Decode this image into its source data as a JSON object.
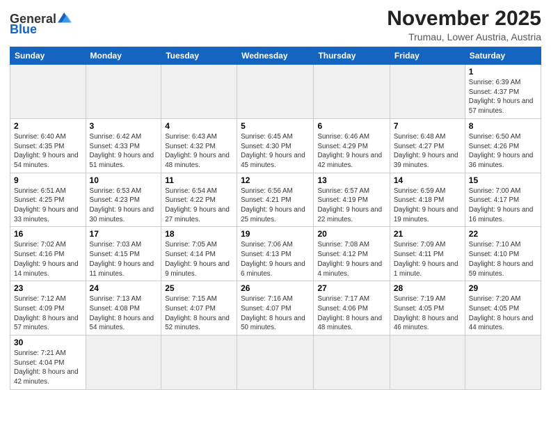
{
  "logo": {
    "general": "General",
    "blue": "Blue"
  },
  "header": {
    "month_title": "November 2025",
    "subtitle": "Trumau, Lower Austria, Austria"
  },
  "weekdays": [
    "Sunday",
    "Monday",
    "Tuesday",
    "Wednesday",
    "Thursday",
    "Friday",
    "Saturday"
  ],
  "weeks": [
    [
      {
        "day": "",
        "empty": true
      },
      {
        "day": "",
        "empty": true
      },
      {
        "day": "",
        "empty": true
      },
      {
        "day": "",
        "empty": true
      },
      {
        "day": "",
        "empty": true
      },
      {
        "day": "",
        "empty": true
      },
      {
        "day": "1",
        "info": "Sunrise: 6:39 AM\nSunset: 4:37 PM\nDaylight: 9 hours\nand 57 minutes."
      }
    ],
    [
      {
        "day": "2",
        "info": "Sunrise: 6:40 AM\nSunset: 4:35 PM\nDaylight: 9 hours\nand 54 minutes."
      },
      {
        "day": "3",
        "info": "Sunrise: 6:42 AM\nSunset: 4:33 PM\nDaylight: 9 hours\nand 51 minutes."
      },
      {
        "day": "4",
        "info": "Sunrise: 6:43 AM\nSunset: 4:32 PM\nDaylight: 9 hours\nand 48 minutes."
      },
      {
        "day": "5",
        "info": "Sunrise: 6:45 AM\nSunset: 4:30 PM\nDaylight: 9 hours\nand 45 minutes."
      },
      {
        "day": "6",
        "info": "Sunrise: 6:46 AM\nSunset: 4:29 PM\nDaylight: 9 hours\nand 42 minutes."
      },
      {
        "day": "7",
        "info": "Sunrise: 6:48 AM\nSunset: 4:27 PM\nDaylight: 9 hours\nand 39 minutes."
      },
      {
        "day": "8",
        "info": "Sunrise: 6:50 AM\nSunset: 4:26 PM\nDaylight: 9 hours\nand 36 minutes."
      }
    ],
    [
      {
        "day": "9",
        "info": "Sunrise: 6:51 AM\nSunset: 4:25 PM\nDaylight: 9 hours\nand 33 minutes."
      },
      {
        "day": "10",
        "info": "Sunrise: 6:53 AM\nSunset: 4:23 PM\nDaylight: 9 hours\nand 30 minutes."
      },
      {
        "day": "11",
        "info": "Sunrise: 6:54 AM\nSunset: 4:22 PM\nDaylight: 9 hours\nand 27 minutes."
      },
      {
        "day": "12",
        "info": "Sunrise: 6:56 AM\nSunset: 4:21 PM\nDaylight: 9 hours\nand 25 minutes."
      },
      {
        "day": "13",
        "info": "Sunrise: 6:57 AM\nSunset: 4:19 PM\nDaylight: 9 hours\nand 22 minutes."
      },
      {
        "day": "14",
        "info": "Sunrise: 6:59 AM\nSunset: 4:18 PM\nDaylight: 9 hours\nand 19 minutes."
      },
      {
        "day": "15",
        "info": "Sunrise: 7:00 AM\nSunset: 4:17 PM\nDaylight: 9 hours\nand 16 minutes."
      }
    ],
    [
      {
        "day": "16",
        "info": "Sunrise: 7:02 AM\nSunset: 4:16 PM\nDaylight: 9 hours\nand 14 minutes."
      },
      {
        "day": "17",
        "info": "Sunrise: 7:03 AM\nSunset: 4:15 PM\nDaylight: 9 hours\nand 11 minutes."
      },
      {
        "day": "18",
        "info": "Sunrise: 7:05 AM\nSunset: 4:14 PM\nDaylight: 9 hours\nand 9 minutes."
      },
      {
        "day": "19",
        "info": "Sunrise: 7:06 AM\nSunset: 4:13 PM\nDaylight: 9 hours\nand 6 minutes."
      },
      {
        "day": "20",
        "info": "Sunrise: 7:08 AM\nSunset: 4:12 PM\nDaylight: 9 hours\nand 4 minutes."
      },
      {
        "day": "21",
        "info": "Sunrise: 7:09 AM\nSunset: 4:11 PM\nDaylight: 9 hours\nand 1 minute."
      },
      {
        "day": "22",
        "info": "Sunrise: 7:10 AM\nSunset: 4:10 PM\nDaylight: 8 hours\nand 59 minutes."
      }
    ],
    [
      {
        "day": "23",
        "info": "Sunrise: 7:12 AM\nSunset: 4:09 PM\nDaylight: 8 hours\nand 57 minutes."
      },
      {
        "day": "24",
        "info": "Sunrise: 7:13 AM\nSunset: 4:08 PM\nDaylight: 8 hours\nand 54 minutes."
      },
      {
        "day": "25",
        "info": "Sunrise: 7:15 AM\nSunset: 4:07 PM\nDaylight: 8 hours\nand 52 minutes."
      },
      {
        "day": "26",
        "info": "Sunrise: 7:16 AM\nSunset: 4:07 PM\nDaylight: 8 hours\nand 50 minutes."
      },
      {
        "day": "27",
        "info": "Sunrise: 7:17 AM\nSunset: 4:06 PM\nDaylight: 8 hours\nand 48 minutes."
      },
      {
        "day": "28",
        "info": "Sunrise: 7:19 AM\nSunset: 4:05 PM\nDaylight: 8 hours\nand 46 minutes."
      },
      {
        "day": "29",
        "info": "Sunrise: 7:20 AM\nSunset: 4:05 PM\nDaylight: 8 hours\nand 44 minutes."
      }
    ],
    [
      {
        "day": "30",
        "info": "Sunrise: 7:21 AM\nSunset: 4:04 PM\nDaylight: 8 hours\nand 42 minutes."
      },
      {
        "day": "",
        "empty": true
      },
      {
        "day": "",
        "empty": true
      },
      {
        "day": "",
        "empty": true
      },
      {
        "day": "",
        "empty": true
      },
      {
        "day": "",
        "empty": true
      },
      {
        "day": "",
        "empty": true
      }
    ]
  ]
}
